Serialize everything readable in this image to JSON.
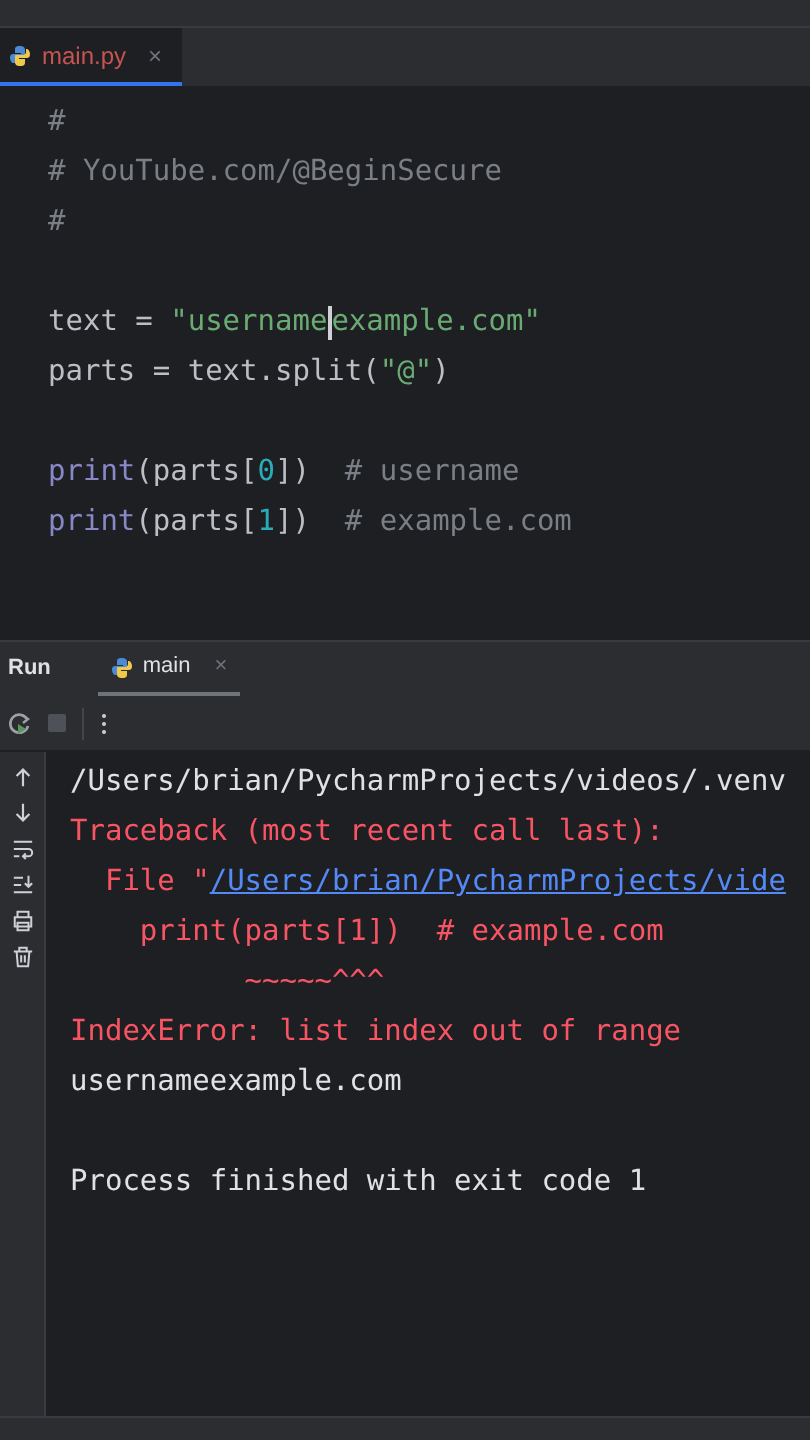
{
  "editor_tabs": [
    {
      "label": "main.py",
      "selected": true,
      "has_error": true,
      "close": "×"
    }
  ],
  "code_lines": [
    {
      "kind": "code",
      "tokens": [
        {
          "kind": "comment",
          "text": "#"
        }
      ]
    },
    {
      "kind": "code",
      "tokens": [
        {
          "kind": "comment",
          "text": "# YouTube.com/@BeginSecure"
        }
      ]
    },
    {
      "kind": "code",
      "tokens": [
        {
          "kind": "comment",
          "text": "#"
        }
      ]
    },
    {
      "kind": "blank"
    },
    {
      "kind": "code",
      "tokens": [
        {
          "kind": "plain",
          "text": "text = "
        },
        {
          "kind": "string",
          "text": "\"username"
        },
        {
          "kind": "caret"
        },
        {
          "kind": "string",
          "text": "example.com\""
        }
      ]
    },
    {
      "kind": "code",
      "tokens": [
        {
          "kind": "plain",
          "text": "parts = text.split("
        },
        {
          "kind": "string",
          "text": "\"@\""
        },
        {
          "kind": "plain",
          "text": ")"
        }
      ]
    },
    {
      "kind": "blank"
    },
    {
      "kind": "code",
      "tokens": [
        {
          "kind": "builtin",
          "text": "print"
        },
        {
          "kind": "plain",
          "text": "(parts["
        },
        {
          "kind": "number",
          "text": "0"
        },
        {
          "kind": "plain",
          "text": "])  "
        },
        {
          "kind": "comment",
          "text": "# username"
        }
      ]
    },
    {
      "kind": "code",
      "tokens": [
        {
          "kind": "builtin",
          "text": "print"
        },
        {
          "kind": "plain",
          "text": "(parts["
        },
        {
          "kind": "number",
          "text": "1"
        },
        {
          "kind": "plain",
          "text": "])  "
        },
        {
          "kind": "comment",
          "text": "# example.com"
        }
      ]
    }
  ],
  "run_panel": {
    "title": "Run",
    "tabs": [
      {
        "label": "main",
        "selected": true,
        "close": "×"
      }
    ]
  },
  "console_lines": [
    {
      "kind": "line",
      "tokens": [
        {
          "kind": "normal",
          "text": "/Users/brian/PycharmProjects/videos/.venv"
        }
      ]
    },
    {
      "kind": "line",
      "tokens": [
        {
          "kind": "error",
          "text": "Traceback (most recent call last):"
        }
      ]
    },
    {
      "kind": "line",
      "tokens": [
        {
          "kind": "error",
          "text": "  File \""
        },
        {
          "kind": "link",
          "text": "/Users/brian/PycharmProjects/vide"
        }
      ]
    },
    {
      "kind": "line",
      "tokens": [
        {
          "kind": "error",
          "text": "    print(parts[1])  # example.com"
        }
      ]
    },
    {
      "kind": "line",
      "tokens": [
        {
          "kind": "error",
          "text": "          ~~~~~^^^"
        }
      ]
    },
    {
      "kind": "line",
      "tokens": [
        {
          "kind": "error",
          "text": "IndexError: list index out of range"
        }
      ]
    },
    {
      "kind": "line",
      "tokens": [
        {
          "kind": "normal",
          "text": "usernameexample.com"
        }
      ]
    },
    {
      "kind": "blank"
    },
    {
      "kind": "line",
      "tokens": [
        {
          "kind": "normal",
          "text": "Process finished with exit code 1"
        }
      ]
    }
  ]
}
